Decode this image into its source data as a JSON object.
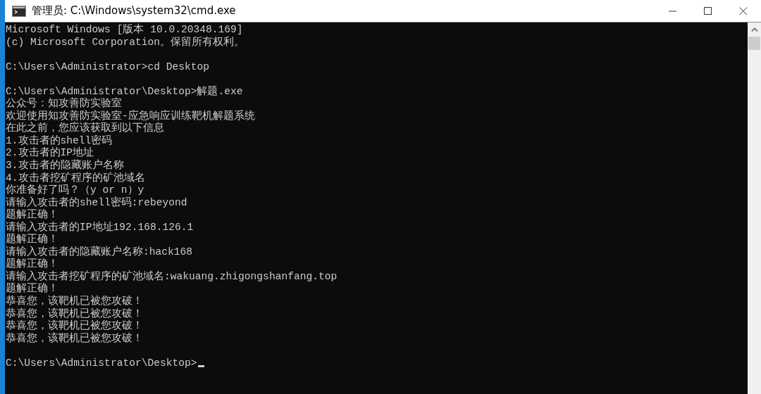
{
  "window": {
    "title": "管理员: C:\\Windows\\system32\\cmd.exe"
  },
  "console": {
    "lines": [
      {
        "kind": "text",
        "text": "Microsoft Windows [版本 10.0.20348.169]"
      },
      {
        "kind": "text",
        "text": "(c) Microsoft Corporation。保留所有权利。"
      },
      {
        "kind": "blank"
      },
      {
        "kind": "text",
        "text": "C:\\Users\\Administrator>cd Desktop"
      },
      {
        "kind": "blank"
      },
      {
        "kind": "text",
        "text": "C:\\Users\\Administrator\\Desktop>解题.exe"
      },
      {
        "kind": "text",
        "text": "公众号：知攻善防实验室"
      },
      {
        "kind": "text",
        "text": "欢迎使用知攻善防实验室-应急响应训练靶机解题系统"
      },
      {
        "kind": "text",
        "text": "在此之前，您应该获取到以下信息"
      },
      {
        "kind": "text",
        "text": "1.攻击者的shell密码"
      },
      {
        "kind": "text",
        "text": "2.攻击者的IP地址"
      },
      {
        "kind": "text",
        "text": "3.攻击者的隐藏账户名称"
      },
      {
        "kind": "text",
        "text": "4.攻击者挖矿程序的矿池域名"
      },
      {
        "kind": "text",
        "text": "你准备好了吗？（y or n）y"
      },
      {
        "kind": "text",
        "text": "请输入攻击者的shell密码:rebeyond"
      },
      {
        "kind": "text",
        "text": "题解正确！"
      },
      {
        "kind": "text",
        "text": "请输入攻击者的IP地址192.168.126.1"
      },
      {
        "kind": "text",
        "text": "题解正确！"
      },
      {
        "kind": "text",
        "text": "请输入攻击者的隐藏账户名称:hack168"
      },
      {
        "kind": "text",
        "text": "题解正确！"
      },
      {
        "kind": "text",
        "text": "请输入攻击者挖矿程序的矿池域名:wakuang.zhigongshanfang.top"
      },
      {
        "kind": "text",
        "text": "题解正确！"
      },
      {
        "kind": "text",
        "text": "恭喜您，该靶机已被您攻破！"
      },
      {
        "kind": "text",
        "text": "恭喜您，该靶机已被您攻破！"
      },
      {
        "kind": "text",
        "text": "恭喜您，该靶机已被您攻破！"
      },
      {
        "kind": "text",
        "text": "恭喜您，该靶机已被您攻破！"
      },
      {
        "kind": "blank"
      },
      {
        "kind": "prompt",
        "text": "C:\\Users\\Administrator\\Desktop>"
      }
    ]
  }
}
